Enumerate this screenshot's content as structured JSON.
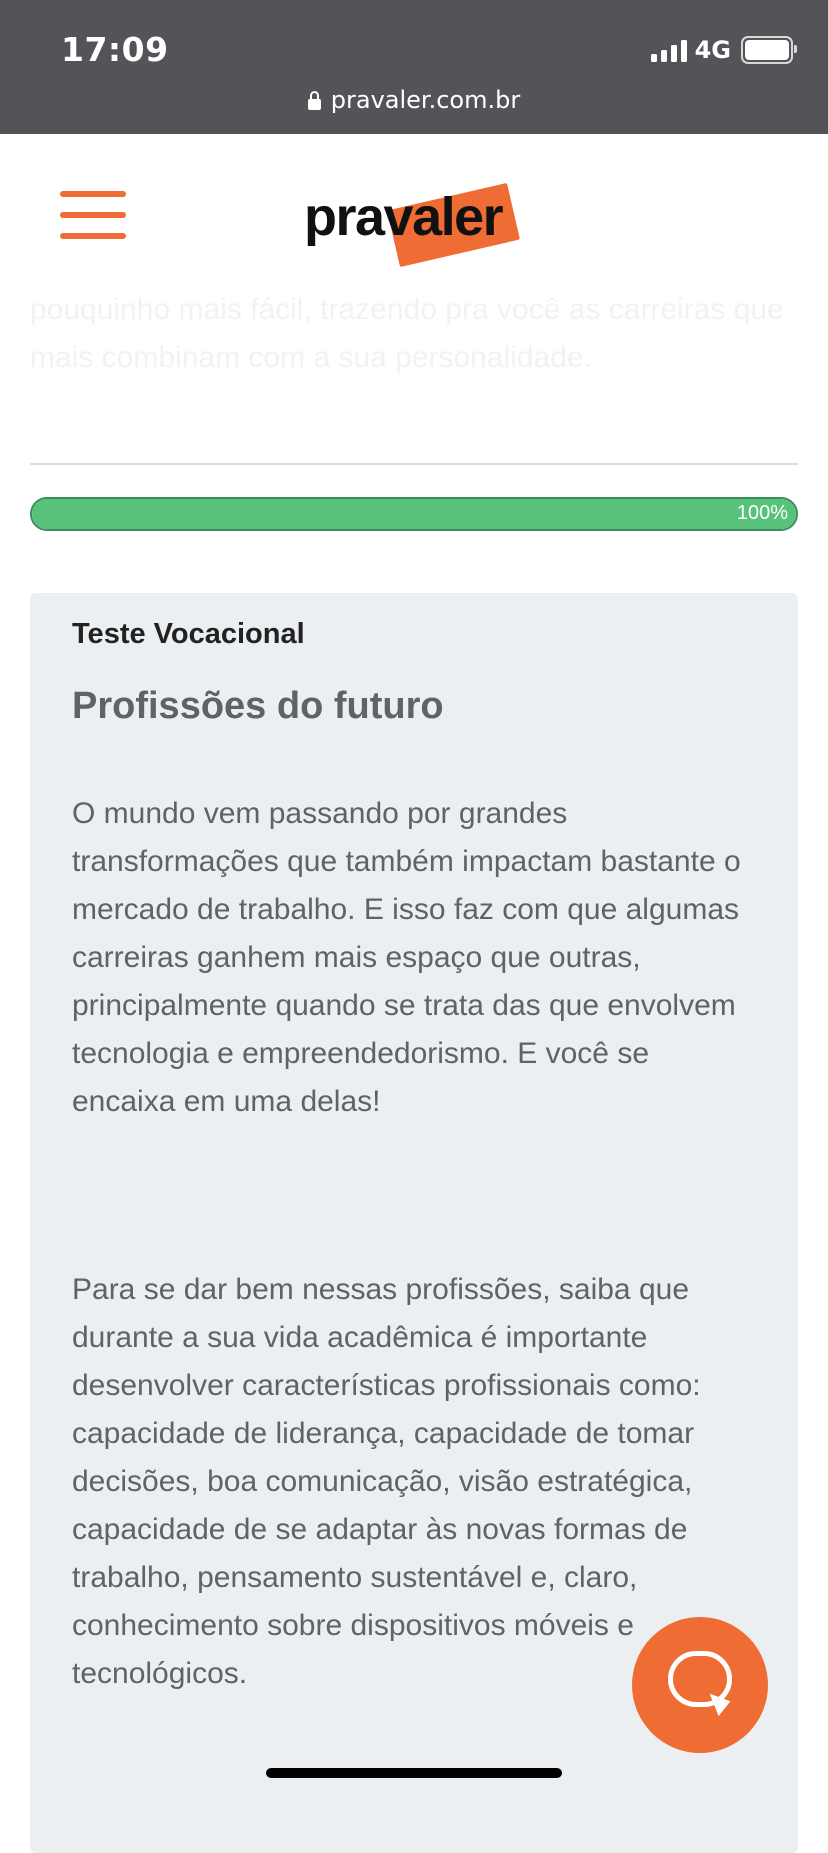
{
  "status_bar": {
    "time": "17:09",
    "network": "4G"
  },
  "browser": {
    "url": "pravaler.com.br"
  },
  "header": {
    "logo_text": "pravaler"
  },
  "intro": {
    "faded_text": "pouquinho mais fácil, trazendo pra você as carreiras que mais combinam com a sua personalidade."
  },
  "progress": {
    "label": "100%",
    "value": 1.0
  },
  "result": {
    "kicker": "Teste Vocacional",
    "title": "Profissões do futuro",
    "paragraph_1": "O mundo vem passando por grandes transformações que também impactam bastante o mercado de trabalho. E isso faz com que algumas carreiras ganhem mais espaço que outras, principalmente quando se trata das que envolvem tecnologia e empreendedorismo. E você se encaixa em uma delas!",
    "paragraph_2": "Para se dar bem nessas profissões, saiba que durante a sua vida acadêmica é importante desenvolver características profissionais como: capacidade de liderança, capacidade de tomar decisões, boa comunicação, visão estratégica, capacidade de se adaptar às novas formas de trabalho, pensamento sustentável e, claro, conhecimento sobre dispositivos móveis e tecnológicos."
  },
  "colors": {
    "brand": "#ef6c35",
    "progress": "#58c17c",
    "card_bg": "#eceff1",
    "text": "#5e6369"
  },
  "icons": [
    "lock-icon",
    "menu-icon",
    "chat-icon",
    "signal-icon",
    "battery-icon"
  ]
}
